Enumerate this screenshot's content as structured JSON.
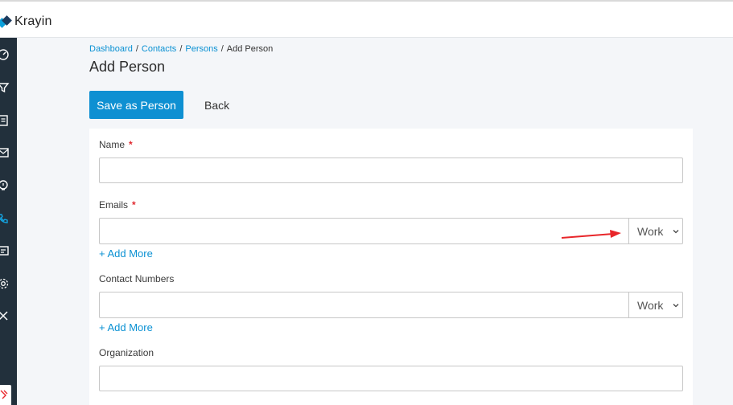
{
  "app": {
    "name": "Krayin",
    "accent": "#0e90d2",
    "sidebar_bg": "#22303c"
  },
  "sidebar": {
    "items": [
      {
        "icon": "dashboard-icon"
      },
      {
        "icon": "filter-icon"
      },
      {
        "icon": "quote-icon"
      },
      {
        "icon": "mail-icon"
      },
      {
        "icon": "activity-icon"
      },
      {
        "icon": "contacts-icon"
      },
      {
        "icon": "products-icon"
      },
      {
        "icon": "settings-icon"
      },
      {
        "icon": "configuration-icon"
      }
    ]
  },
  "breadcrumb": {
    "items": [
      "Dashboard",
      "Contacts",
      "Persons"
    ],
    "current": "Add Person",
    "separator": "/"
  },
  "page": {
    "title": "Add Person"
  },
  "actions": {
    "save_label": "Save as Person",
    "back_label": "Back"
  },
  "form": {
    "required_marker": "*",
    "name": {
      "label": "Name",
      "value": ""
    },
    "emails": {
      "label": "Emails",
      "value": "",
      "type": "Work",
      "add_more": "+ Add More"
    },
    "contact_numbers": {
      "label": "Contact Numbers",
      "value": "",
      "type": "Work",
      "add_more": "+ Add More"
    },
    "organization": {
      "label": "Organization",
      "value": ""
    }
  },
  "annotation": {
    "color": "#e8262a"
  }
}
